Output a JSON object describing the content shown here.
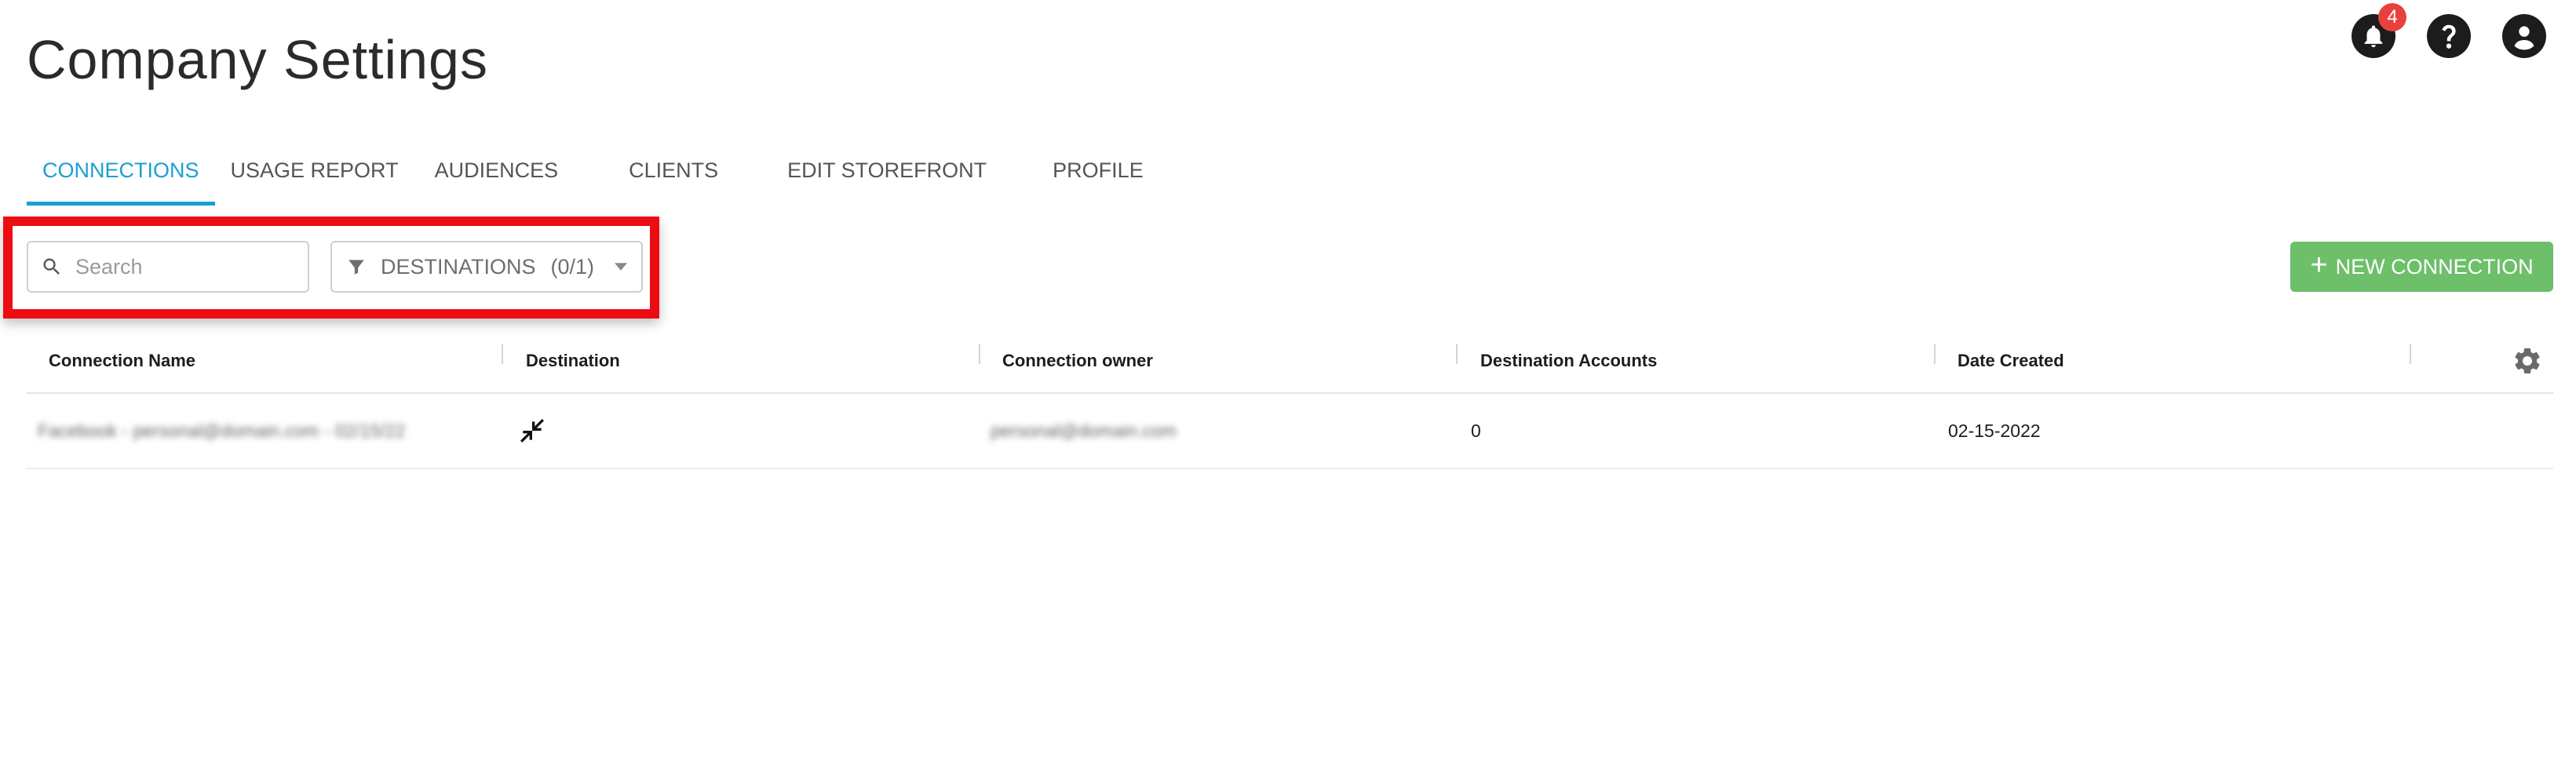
{
  "page": {
    "title": "Company Settings"
  },
  "header": {
    "notifications_count": "4",
    "icons": [
      "bell-icon",
      "help-icon",
      "account-icon"
    ]
  },
  "tabs": [
    {
      "label": "CONNECTIONS",
      "active": true
    },
    {
      "label": "USAGE REPORT",
      "active": false
    },
    {
      "label": "AUDIENCES",
      "active": false
    },
    {
      "label": "CLIENTS",
      "active": false
    },
    {
      "label": "EDIT STOREFRONT",
      "active": false
    },
    {
      "label": "PROFILE",
      "active": false
    }
  ],
  "toolbar": {
    "search_placeholder": "Search",
    "filter_label": "DESTINATIONS",
    "filter_count": "(0/1)",
    "new_connection_label": "NEW CONNECTION"
  },
  "table": {
    "columns": [
      "Connection Name",
      "Destination",
      "Connection owner",
      "Destination Accounts",
      "Date Created"
    ],
    "rows": [
      {
        "connection_name": "Facebook - personal@domain.com - 02/15/22",
        "destination_icon": "collapse-arrows-icon",
        "connection_owner": "personal@domain.com",
        "destination_accounts": "0",
        "date_created": "02-15-2022"
      }
    ]
  },
  "colors": {
    "accent": "#1a9fd4",
    "primary_button": "#6dbf6a",
    "highlight": "#ec0c12",
    "badge": "#e8413d"
  }
}
